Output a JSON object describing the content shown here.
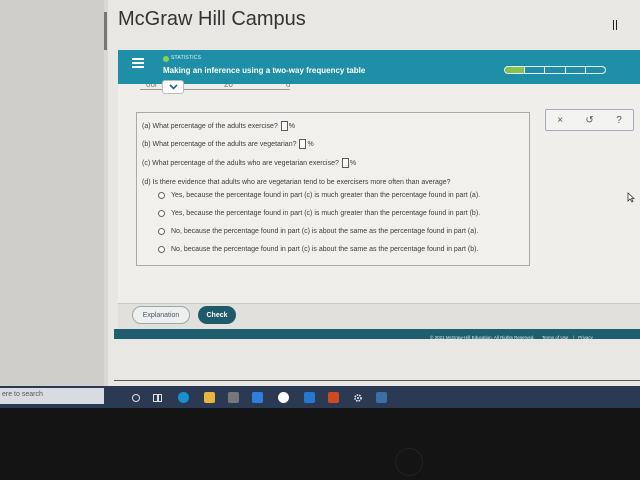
{
  "campus": {
    "title": "McGraw Hill Campus"
  },
  "topbar": {
    "topic": "STATISTICS",
    "lesson_title": "Making an inference using a two-way frequency table",
    "progress_done_segments": 1,
    "progress_total_segments": 5,
    "color": "#1f8fa8"
  },
  "partial_row": {
    "left_text": "ooi",
    "mid_text": "20",
    "right_text": "o"
  },
  "questions": {
    "a": {
      "text": "(a) What percentage of the adults exercise?",
      "unit": "%"
    },
    "b": {
      "text": "(b) What percentage of the adults are vegetarian?",
      "unit": "%"
    },
    "c": {
      "text": "(c) What percentage of the adults who are vegetarian exercise?",
      "unit": "%"
    },
    "d": {
      "text": "(d) Is there evidence that adults who are vegetarian tend to be exercisers more often than average?"
    }
  },
  "options": [
    "Yes, because the percentage found in part (c) is much greater than the percentage found in part (a).",
    "Yes, because the percentage found in part (c) is much greater than the percentage found in part (b).",
    "No, because the percentage found in part (c) is about the same as the percentage found in part (a).",
    "No, because the percentage found in part (c) is about the same as the percentage found in part (b)."
  ],
  "tools": {
    "close": "×",
    "undo": "↺",
    "help": "?"
  },
  "buttons": {
    "explanation": "Explanation",
    "check": "Check",
    "check_color": "#1f5a6a"
  },
  "footer": {
    "copyright": "© 2021 McGraw-Hill Education. All Rights Reserved.",
    "terms": "Terms of Use",
    "privacy": "Privacy"
  },
  "taskbar": {
    "search_text": "ere to search"
  }
}
